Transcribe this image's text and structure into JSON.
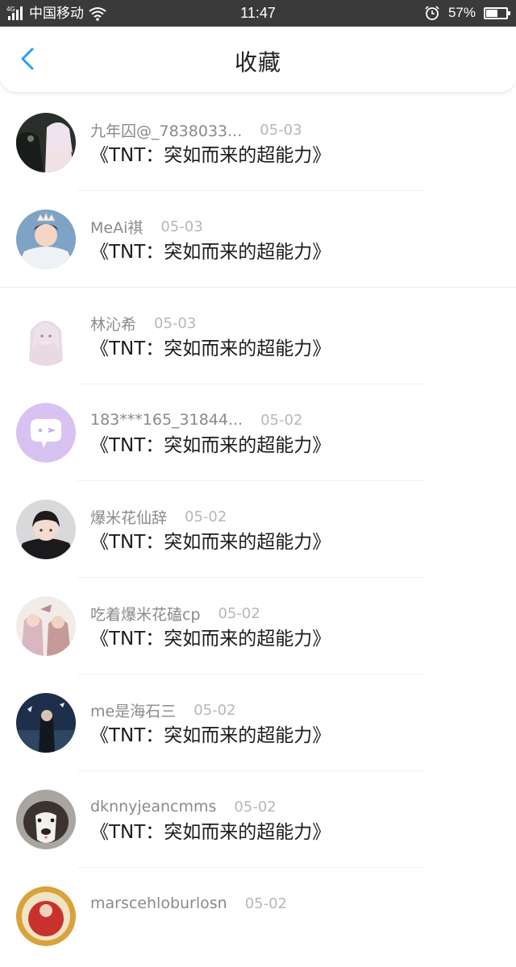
{
  "status_bar": {
    "network": "4G",
    "carrier": "中国移动",
    "time": "11:47",
    "battery": "57%",
    "battery_level": 0.57
  },
  "header": {
    "title": "收藏"
  },
  "favorites": [
    {
      "user": "九年囚@_7838033...",
      "date": "05-03",
      "book": "《TNT：突如而来的超能力》"
    },
    {
      "user": "MeAi祺",
      "date": "05-03",
      "book": "《TNT：突如而来的超能力》"
    },
    {
      "user": "林沁希",
      "date": "05-03",
      "book": "《TNT：突如而来的超能力》"
    },
    {
      "user": "183***165_31844...",
      "date": "05-02",
      "book": "《TNT：突如而来的超能力》"
    },
    {
      "user": "爆米花仙辞",
      "date": "05-02",
      "book": "《TNT：突如而来的超能力》"
    },
    {
      "user": "吃着爆米花磕cp",
      "date": "05-02",
      "book": "《TNT：突如而来的超能力》"
    },
    {
      "user": "me是海石三",
      "date": "05-02",
      "book": "《TNT：突如而来的超能力》"
    },
    {
      "user": "dknnyjeancmms",
      "date": "05-02",
      "book": "《TNT：突如而来的超能力》"
    },
    {
      "user": "marscehloburlosn",
      "date": "05-02",
      "book": ""
    }
  ],
  "colors": {
    "accent": "#2a9df4",
    "statusbar_bg": "#3a3a3a",
    "username": "#8a8a8a",
    "date": "#b7b7b7",
    "title": "#1c1c1c"
  }
}
